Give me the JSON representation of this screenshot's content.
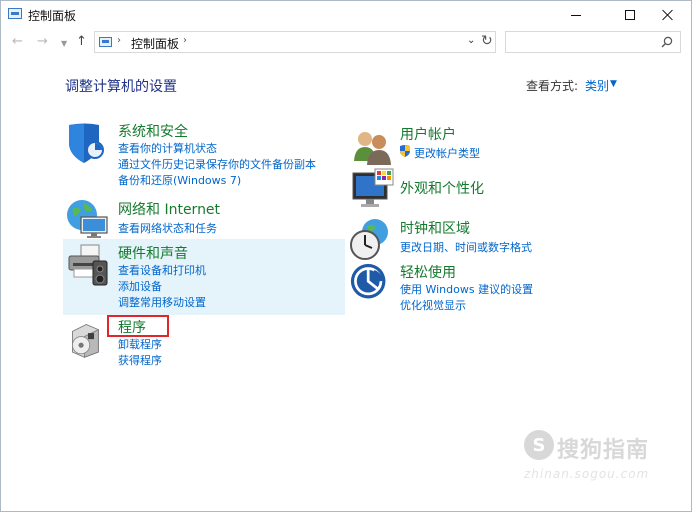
{
  "window": {
    "title": "控制面板"
  },
  "address": {
    "path": "控制面板",
    "search_placeholder": ""
  },
  "header": {
    "title": "调整计算机的设置",
    "viewby_label": "查看方式:",
    "viewby_value": "类别"
  },
  "categories": [
    {
      "title": "系统和安全",
      "links": [
        "查看你的计算机状态",
        "通过文件历史记录保存你的文件备份副本",
        "备份和还原(Windows 7)"
      ]
    },
    {
      "title": "网络和 Internet",
      "links": [
        "查看网络状态和任务"
      ]
    },
    {
      "title": "硬件和声音",
      "links": [
        "查看设备和打印机",
        "添加设备",
        "调整常用移动设置"
      ]
    },
    {
      "title": "程序",
      "links": [
        "卸载程序",
        "获得程序"
      ]
    },
    {
      "title": "用户帐户",
      "links": [
        "更改帐户类型"
      ]
    },
    {
      "title": "外观和个性化",
      "links": []
    },
    {
      "title": "时钟和区域",
      "links": [
        "更改日期、时间或数字格式"
      ]
    },
    {
      "title": "轻松使用",
      "links": [
        "使用 Windows 建议的设置",
        "优化视觉显示"
      ]
    }
  ],
  "watermark": {
    "text": "搜狗指南",
    "url": "zhinan.sogou.com",
    "logo": "S"
  },
  "colors": {
    "title_blue": "#1e3287",
    "category_green": "#157a2e",
    "link_blue": "#0066cc",
    "highlight_red": "#e0252b",
    "hover_bg": "#e5f3fb"
  }
}
